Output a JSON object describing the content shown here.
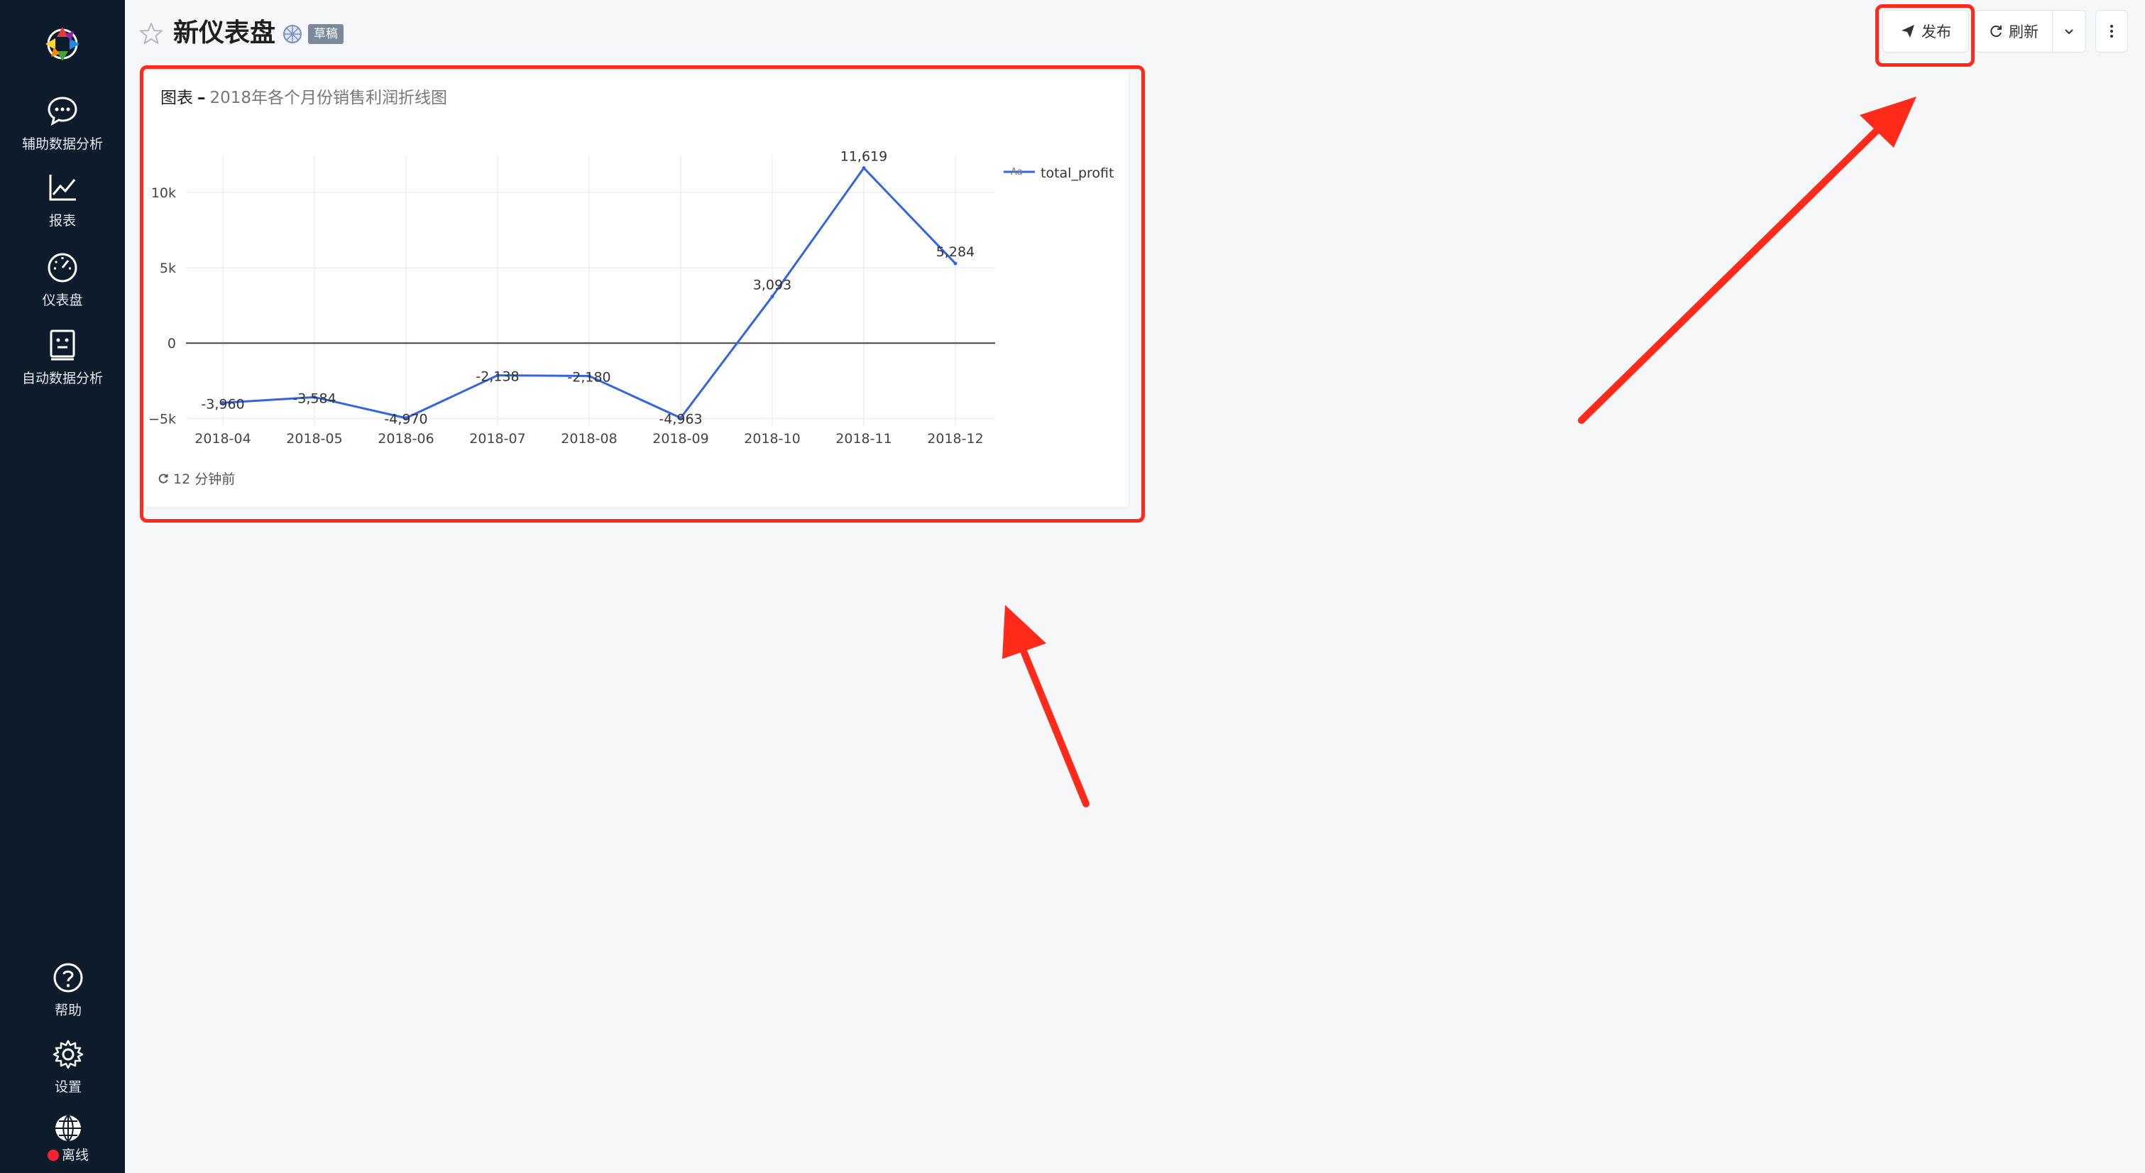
{
  "sidebar": {
    "items": [
      {
        "label": "辅助数据分析",
        "icon": "chat-analysis-icon"
      },
      {
        "label": "报表",
        "icon": "line-chart-icon"
      },
      {
        "label": "仪表盘",
        "icon": "gauge-icon"
      },
      {
        "label": "自动数据分析",
        "icon": "robot-icon"
      }
    ],
    "bottom": [
      {
        "label": "帮助",
        "icon": "help-icon"
      },
      {
        "label": "设置",
        "icon": "settings-icon"
      },
      {
        "label": "离线",
        "icon": "globe-icon"
      }
    ]
  },
  "header": {
    "title": "新仪表盘",
    "badge": "草稿",
    "publish_label": "发布",
    "refresh_label": "刷新"
  },
  "card": {
    "prefix": "图表",
    "separator": "–",
    "subtitle": "2018年各个月份销售利润折线图",
    "updated": "12 分钟前"
  },
  "colors": {
    "sidebar_bg": "#0e1b2b",
    "line": "#3366dd",
    "highlight": "#ff2a1a",
    "badge": "#7a8a9a"
  },
  "chart_data": {
    "type": "line",
    "x": [
      "2018-04",
      "2018-05",
      "2018-06",
      "2018-07",
      "2018-08",
      "2018-09",
      "2018-10",
      "2018-11",
      "2018-12"
    ],
    "series": [
      {
        "name": "total_profit",
        "values": [
          -3960,
          -3584,
          -4970,
          -2138,
          -2180,
          -4963,
          3093,
          11619,
          5284
        ],
        "labels": [
          "-3,960",
          "-3,584",
          "-4,970",
          "-2,138",
          "-2,180",
          "-4,963",
          "3,093",
          "11,619",
          "5,284"
        ]
      }
    ],
    "yticks": [
      -5000,
      0,
      5000,
      10000
    ],
    "ytick_labels": [
      "−5k",
      "0",
      "5k",
      "10k"
    ],
    "ylim": [
      -5500,
      12400
    ],
    "grid": true,
    "legend": "top-right",
    "legend_symbol": "Aa"
  }
}
